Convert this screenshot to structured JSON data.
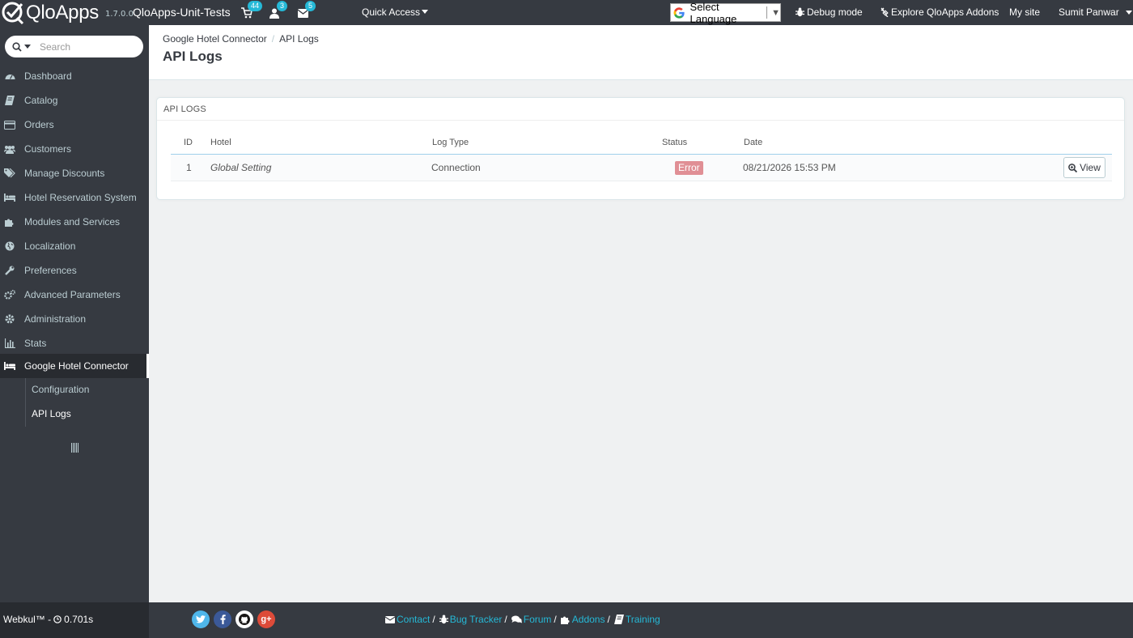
{
  "header": {
    "brand": "QloApps",
    "version": "1.7.0.0",
    "shop_name": "QloApps-Unit-Tests",
    "notifications": {
      "orders": "44",
      "customers": "3",
      "messages": "5"
    },
    "quick_access": "Quick Access",
    "language": "Select Language",
    "debug_mode": "Debug mode",
    "explore_addons": "Explore QloApps Addons",
    "my_site": "My site",
    "user": "Sumit Panwar"
  },
  "sidebar": {
    "search_placeholder": "Search",
    "items": [
      {
        "label": "Dashboard",
        "icon": "dashboard-icon"
      },
      {
        "label": "Catalog",
        "icon": "book-icon"
      },
      {
        "label": "Orders",
        "icon": "credit-card-icon"
      },
      {
        "label": "Customers",
        "icon": "users-icon"
      },
      {
        "label": "Manage Discounts",
        "icon": "tags-icon"
      },
      {
        "label": "Hotel Reservation System",
        "icon": "bed-icon"
      },
      {
        "label": "Modules and Services",
        "icon": "puzzle-icon"
      },
      {
        "label": "Localization",
        "icon": "globe-icon"
      },
      {
        "label": "Preferences",
        "icon": "wrench-icon"
      },
      {
        "label": "Advanced Parameters",
        "icon": "cogs-icon"
      },
      {
        "label": "Administration",
        "icon": "cog-icon"
      },
      {
        "label": "Stats",
        "icon": "bar-chart-icon"
      },
      {
        "label": "Google Hotel Connector",
        "icon": "bed-icon"
      }
    ],
    "subitems": [
      {
        "label": "Configuration"
      },
      {
        "label": "API Logs"
      }
    ]
  },
  "page": {
    "breadcrumb": [
      "Google Hotel Connector",
      "API Logs"
    ],
    "title": "API Logs"
  },
  "panel": {
    "heading": "API LOGS",
    "columns": [
      "ID",
      "Hotel",
      "Log Type",
      "Status",
      "Date"
    ],
    "rows": [
      {
        "id": "1",
        "hotel": "Global Setting",
        "log_type": "Connection",
        "status": "Error",
        "date": "08/21/2026 15:53 PM",
        "action": "View"
      }
    ]
  },
  "footer": {
    "brand": "Webkul™ -",
    "time": "0.701s",
    "social": [
      "twitter-icon",
      "facebook-icon",
      "github-icon",
      "google-plus-icon"
    ],
    "links": [
      "Contact",
      "Bug Tracker",
      "Forum",
      "Addons",
      "Training"
    ]
  },
  "colors": {
    "header_bg": "#363a41",
    "accent": "#25b9d7",
    "error": "#e08f95",
    "main_bg": "#eff1f2"
  }
}
